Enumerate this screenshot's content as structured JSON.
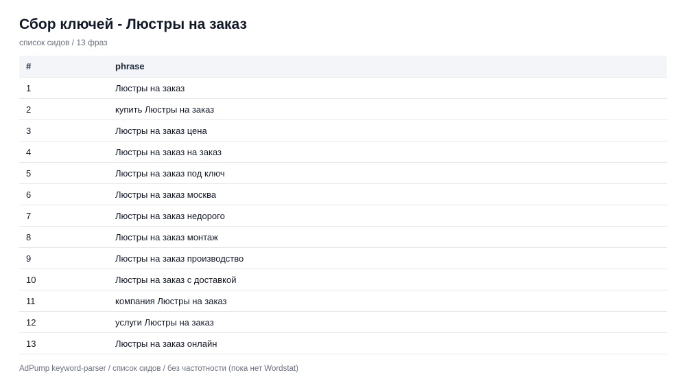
{
  "page": {
    "title": "Сбор ключей - Люстры на заказ",
    "subtitle": "список сидов / 13 фраз"
  },
  "table": {
    "headers": {
      "index": "#",
      "phrase": "phrase"
    },
    "rows": [
      {
        "index": "1",
        "phrase": "Люстры на заказ"
      },
      {
        "index": "2",
        "phrase": "купить Люстры на заказ"
      },
      {
        "index": "3",
        "phrase": "Люстры на заказ цена"
      },
      {
        "index": "4",
        "phrase": "Люстры на заказ на заказ"
      },
      {
        "index": "5",
        "phrase": "Люстры на заказ под ключ"
      },
      {
        "index": "6",
        "phrase": "Люстры на заказ москва"
      },
      {
        "index": "7",
        "phrase": "Люстры на заказ недорого"
      },
      {
        "index": "8",
        "phrase": "Люстры на заказ монтаж"
      },
      {
        "index": "9",
        "phrase": "Люстры на заказ производство"
      },
      {
        "index": "10",
        "phrase": "Люстры на заказ с доставкой"
      },
      {
        "index": "11",
        "phrase": "компания Люстры на заказ"
      },
      {
        "index": "12",
        "phrase": "услуги Люстры на заказ"
      },
      {
        "index": "13",
        "phrase": "Люстры на заказ онлайн"
      }
    ]
  },
  "footer": {
    "text": "AdPump keyword-parser / список сидов / без частотности (пока нет Wordstat)"
  },
  "colors": {
    "header_bg": "#f3f5f9",
    "border": "#e5e7eb",
    "muted_text": "#6b7280"
  }
}
